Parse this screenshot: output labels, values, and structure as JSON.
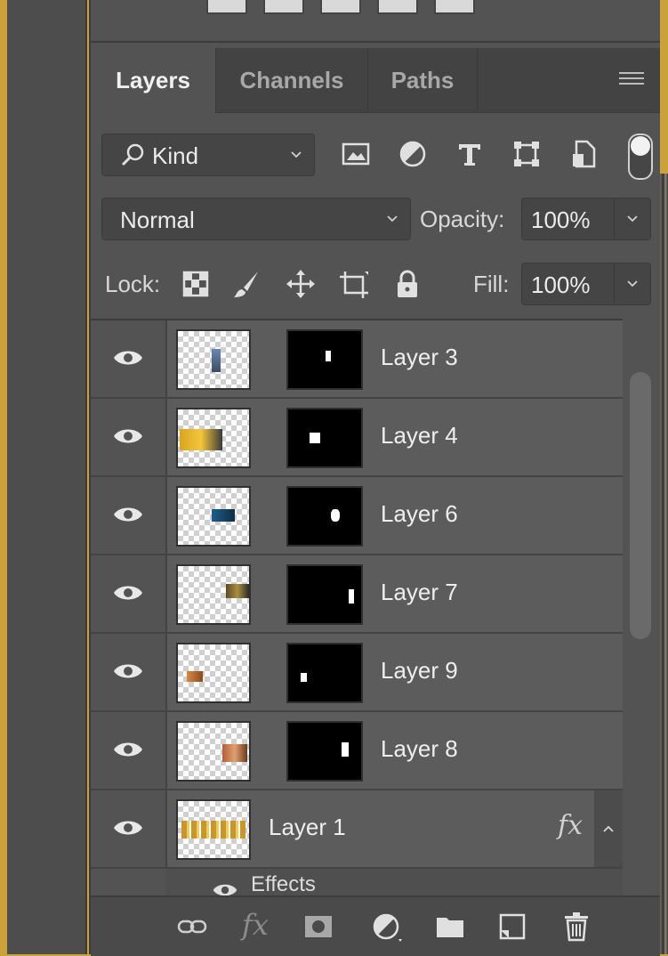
{
  "tabs": [
    {
      "label": "Layers",
      "active": true
    },
    {
      "label": "Channels",
      "active": false
    },
    {
      "label": "Paths",
      "active": false
    }
  ],
  "filter": {
    "kind_label": "Kind",
    "icons": [
      "image-filter-icon",
      "adjustment-filter-icon",
      "type-filter-icon",
      "shape-filter-icon",
      "smart-object-filter-icon"
    ],
    "toggle_on": true
  },
  "blend": {
    "mode": "Normal",
    "opacity_label": "Opacity:",
    "opacity_value": "100%"
  },
  "lock": {
    "label": "Lock:",
    "icons": [
      "lock-transparent-pixels-icon",
      "lock-image-pixels-icon",
      "lock-position-icon",
      "lock-artboard-icon",
      "lock-all-icon"
    ],
    "fill_label": "Fill:",
    "fill_value": "100%"
  },
  "layers": [
    {
      "name": "Layer 3",
      "visible": true,
      "has_mask": true
    },
    {
      "name": "Layer 4",
      "visible": true,
      "has_mask": true
    },
    {
      "name": "Layer 6",
      "visible": true,
      "has_mask": true
    },
    {
      "name": "Layer 7",
      "visible": true,
      "has_mask": true
    },
    {
      "name": "Layer 9",
      "visible": true,
      "has_mask": true
    },
    {
      "name": "Layer 8",
      "visible": true,
      "has_mask": true
    },
    {
      "name": "Layer 1",
      "visible": true,
      "has_mask": false,
      "fx": "fx",
      "effects_label": "Effects"
    }
  ],
  "bottom_bar": {
    "fx": "fx",
    "icons": [
      "link-layers-icon",
      "add-style-icon",
      "add-mask-icon",
      "new-adjustment-icon",
      "new-group-icon",
      "new-layer-icon",
      "delete-layer-icon"
    ]
  },
  "colors": {
    "panel_bg": "#535353",
    "tab_bar_bg": "#434343",
    "layer_row_bg": "#5c5c5c",
    "frame_gold": "#c9a23b"
  }
}
